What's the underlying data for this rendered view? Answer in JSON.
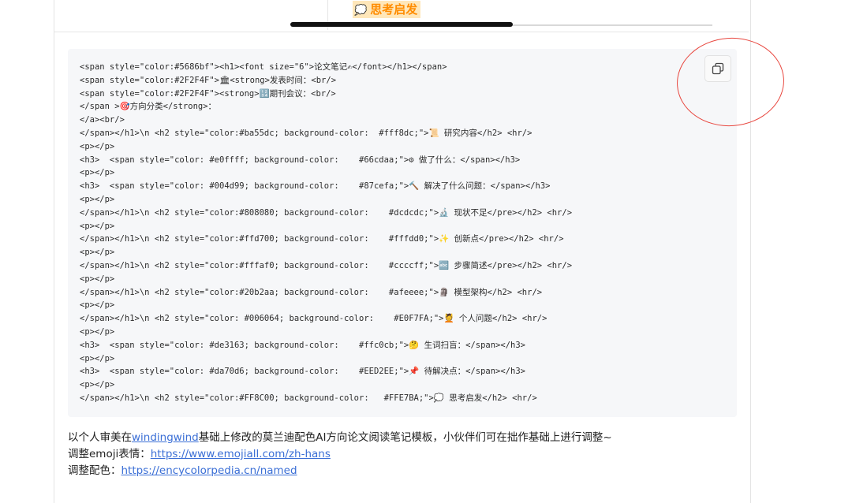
{
  "top": {
    "prev_heading_icon": "💭",
    "prev_heading": "思考启发"
  },
  "code": {
    "lines": [
      "<span style=\"color:#5686bf\"><h1><font size=\"6\">论文笔记✍</font></h1></span>",
      "<span style=\"color:#2F2F4F\">🏛<strong>发表时间：<br/>",
      "<span style=\"color:#2F2F4F\"><strong>🔢期刊会议：<br/>",
      "</span >🎯方向分类</strong>：",
      "</a><br/>",
      "</span></h1>\\n <h2 style=\"color:#ba55dc; background-color:  #fff8dc;\">📜 研究内容</h2> <hr/>",
      "<p></p>",
      "<h3>  <span style=\"color: #e0ffff; background-color:    #66cdaa;\">⚙ 做了什么：</span></h3>",
      "<p></p>",
      "<h3>  <span style=\"color: #004d99; background-color:    #87cefa;\">🔨 解决了什么问题：</span></h3>",
      "<p></p>",
      "</span></h1>\\n <h2 style=\"color:#808080; background-color:    #dcdcdc;\">🔬 现状不足</pre></h2> <hr/>",
      "<p></p>",
      "</span></h1>\\n <h2 style=\"color:#ffd700; background-color:    #fffdd0;\">✨ 创新点</pre></h2> <hr/>",
      "<p></p>",
      "</span></h1>\\n <h2 style=\"color:#fffaf0; background-color:    #ccccff;\">🔤 步骤简述</pre></h2> <hr/>",
      "<p></p>",
      "</span></h1>\\n <h2 style=\"color:#20b2aa; background-color:    #afeeee;\">🗿 模型架构</h2> <hr/>",
      "<p></p>",
      "</span></h1>\\n <h2 style=\"color: #006064; background-color:    #E0F7FA;\">💆 个人问题</h2> <hr/>",
      "<p></p>",
      "<h3>  <span style=\"color: #de3163; background-color:    #ffc0cb;\">🤔 生词扫盲：</span></h3>",
      "<p></p>",
      "<h3>  <span style=\"color: #da70d6; background-color:    #EED2EE;\">📌 待解决点：</span></h3>",
      "<p></p>",
      "</span></h1>\\n <h2 style=\"color:#FF8C00; background-color:   #FFE7BA;\">💭 思考启发</h2> <hr/>"
    ]
  },
  "description": {
    "line1_pre": "以个人审美在",
    "line1_link": "windingwind",
    "line1_post": "基础上修改的莫兰迪配色AI方向论文阅读笔记模板，小伙伴们可在拙作基础上进行调整~",
    "line2_label": "调整emoji表情：",
    "line2_link": "https://www.emojiall.com/zh-hans",
    "line3_label": "调整配色：",
    "line3_link": "https://encycolorpedia.cn/named"
  },
  "colors": {
    "annotation": "#e8473f",
    "link": "#3b6fd6",
    "heading_fg": "#ff8c00",
    "heading_bg": "#ffe7ba"
  },
  "icons": {
    "copy": "copy-icon"
  }
}
